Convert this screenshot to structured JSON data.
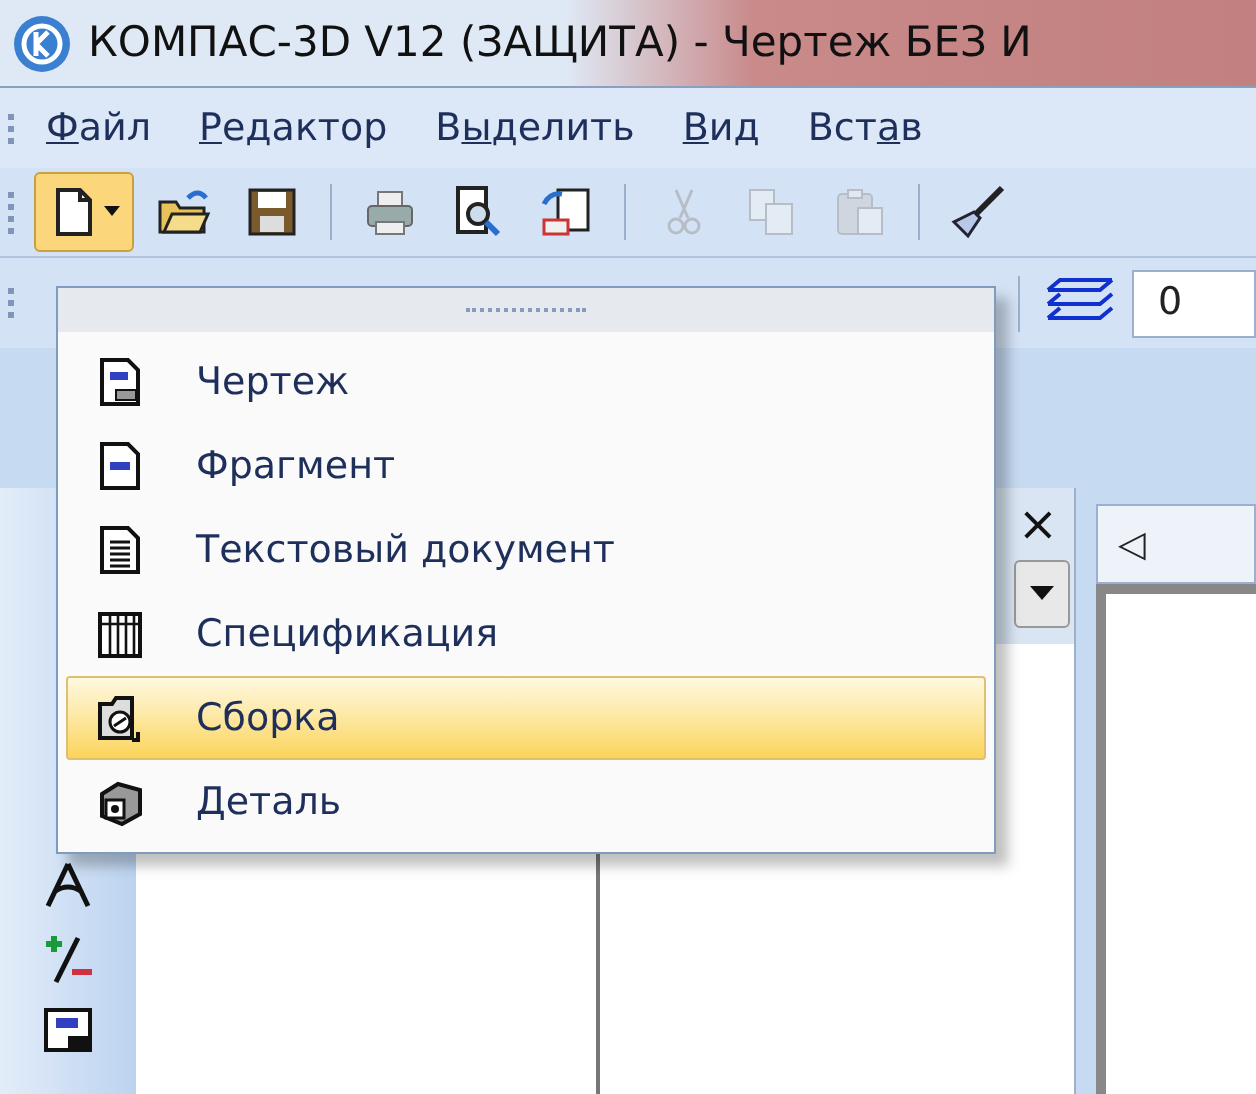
{
  "window": {
    "title_main": "КОМПАС-3D V12",
    "title_rest": "(ЗАЩИТА) - Чертеж БЕЗ И"
  },
  "menu_bar": [
    {
      "key": "Ф",
      "post": "айл"
    },
    {
      "key": "Р",
      "post": "едактор"
    },
    {
      "pre": "В",
      "key": "ы",
      "post": "делить"
    },
    {
      "key": "В",
      "post": "ид"
    },
    {
      "pre": "Вст",
      "key": "а",
      "post": "в"
    }
  ],
  "toolbar": [
    {
      "kind": "new",
      "disabled": false,
      "selected": true
    },
    {
      "kind": "open",
      "disabled": false,
      "selected": false
    },
    {
      "kind": "save",
      "disabled": false,
      "selected": false
    },
    {
      "kind": "separator"
    },
    {
      "kind": "print",
      "disabled": false,
      "selected": false
    },
    {
      "kind": "preview",
      "disabled": false,
      "selected": false
    },
    {
      "kind": "manager",
      "disabled": false,
      "selected": false
    },
    {
      "kind": "separator"
    },
    {
      "kind": "cut",
      "disabled": true,
      "selected": false
    },
    {
      "kind": "copy",
      "disabled": true,
      "selected": false
    },
    {
      "kind": "paste",
      "disabled": true,
      "selected": false
    },
    {
      "kind": "separator"
    },
    {
      "kind": "brush",
      "disabled": false,
      "selected": false
    }
  ],
  "layer_field": {
    "value": "0"
  },
  "new_menu": [
    {
      "kind": "drawing",
      "label": "Чертеж",
      "selected": false
    },
    {
      "kind": "fragment",
      "label": "Фрагмент",
      "selected": false
    },
    {
      "kind": "text",
      "label": "Текстовый документ",
      "selected": false
    },
    {
      "kind": "spec",
      "label": "Спецификация",
      "selected": false
    },
    {
      "kind": "assembly",
      "label": "Сборка",
      "selected": true
    },
    {
      "kind": "part",
      "label": "Деталь",
      "selected": false
    }
  ],
  "panel": {
    "close": "×"
  },
  "document_tab": {
    "arrow": "◁"
  }
}
